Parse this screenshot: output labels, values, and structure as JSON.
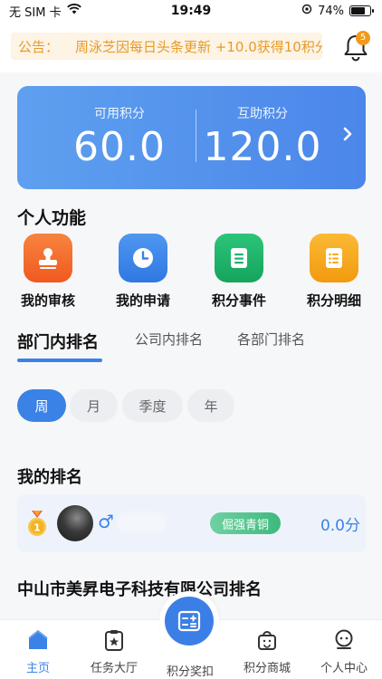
{
  "status_bar": {
    "carrier": "无 SIM 卡",
    "time": "19:49",
    "battery_percent": "74%",
    "battery_level": 0.74
  },
  "notice": {
    "label": "公告：",
    "text": "周泳芝因每日头条更新 +10.0获得10积分",
    "badge_count": "5"
  },
  "points": {
    "available_label": "可用积分",
    "available_value": "60.0",
    "mutual_label": "互助积分",
    "mutual_value": "120.0"
  },
  "personal": {
    "title": "个人功能",
    "items": [
      {
        "label": "我的审核",
        "icon": "stamp-icon",
        "color": "#f26a2e"
      },
      {
        "label": "我的申请",
        "icon": "clock-icon",
        "color": "#3b82e6"
      },
      {
        "label": "积分事件",
        "icon": "document-icon",
        "color": "#21b26a"
      },
      {
        "label": "积分明细",
        "icon": "list-icon",
        "color": "#f5a71c"
      }
    ]
  },
  "ranking_tabs": [
    "部门内排名",
    "公司内排名",
    "各部门排名"
  ],
  "periods": [
    "周",
    "月",
    "季度",
    "年"
  ],
  "my_rank": {
    "title": "我的排名",
    "gender_symbol": "♂",
    "badge": "倔强青铜",
    "score": "0.0分"
  },
  "company_rank": {
    "title": "中山市美昇电子科技有限公司排名"
  },
  "bottom_nav": {
    "items": [
      "主页",
      "任务大厅",
      "积分奖扣",
      "积分商城",
      "个人中心"
    ],
    "active": "主页"
  },
  "colors": {
    "accent": "#3b82e6",
    "notice_text": "#e89a28",
    "card_gradient_start": "#5ea0ef",
    "card_gradient_end": "#4b86ea"
  }
}
